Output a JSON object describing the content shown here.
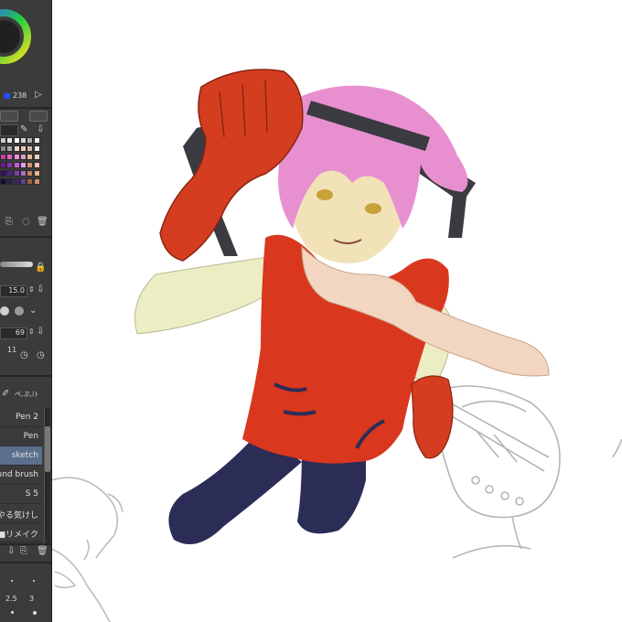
{
  "color_panel": {
    "blue_value": "238",
    "swatch_colors": [
      "#c8c8c8",
      "#e6e6e6",
      "#ffffff",
      "#d8d8d8",
      "#b0b0b0",
      "#f0f0f0",
      "#8a8a8a",
      "#a8a8a8",
      "#f4d4d4",
      "#e8c8b8",
      "#d0b8a8",
      "#f8e8e0",
      "#c0409a",
      "#e060c0",
      "#f090d8",
      "#d8a0c8",
      "#e8b8a0",
      "#f4d0c0",
      "#6a1a8a",
      "#9030b0",
      "#c060d0",
      "#e0a0e8",
      "#d89070",
      "#f0c0a8",
      "#301060",
      "#502080",
      "#8040a0",
      "#b070c0",
      "#c08060",
      "#e8b090",
      "#101030",
      "#202050",
      "#402070",
      "#604090",
      "#a06040",
      "#d09070"
    ]
  },
  "brush_size": {
    "size_value": "15.0",
    "opacity_value": "69",
    "density_value": "11"
  },
  "sub_tool": {
    "header_label": "ペ,ぷ,ﾐﾄ",
    "items": [
      {
        "label": "Pen 2",
        "selected": false
      },
      {
        "label": "Pen",
        "selected": false
      },
      {
        "label": "sketch",
        "selected": true
      },
      {
        "label": "und brush",
        "selected": false
      },
      {
        "label": "S 5",
        "selected": false
      },
      {
        "label": "やる気けし",
        "selected": false
      },
      {
        "label": "彩■リメイク",
        "selected": false
      }
    ]
  },
  "bottom_ruler": {
    "values": [
      "2.5",
      "3"
    ]
  }
}
